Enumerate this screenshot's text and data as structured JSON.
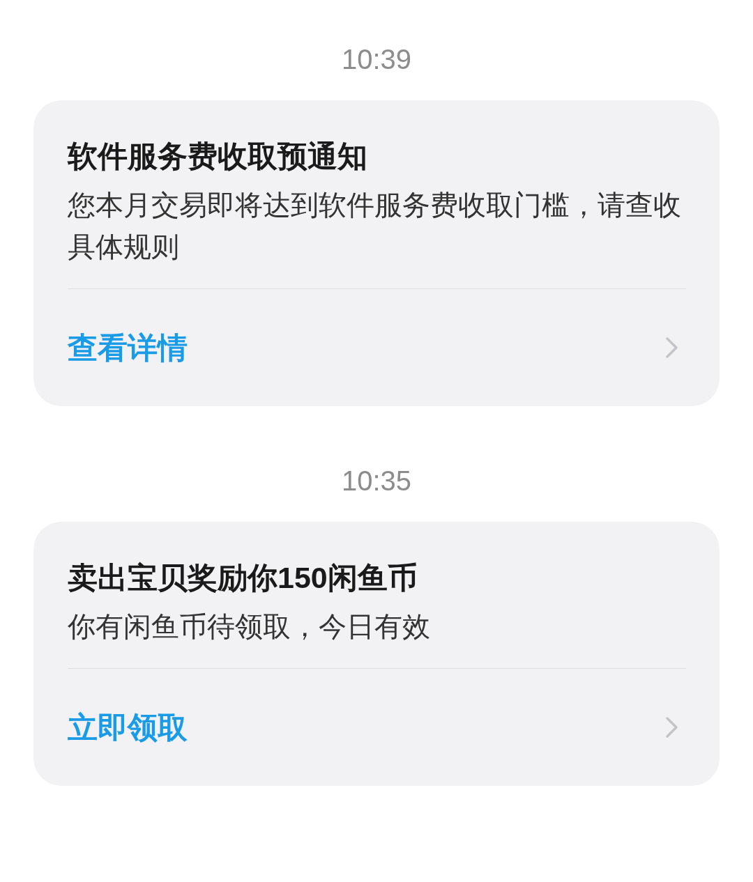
{
  "messages": [
    {
      "time": "10:39",
      "title": "软件服务费收取预通知",
      "body": "您本月交易即将达到软件服务费收取门槛，请查收具体规则",
      "action": "查看详情"
    },
    {
      "time": "10:35",
      "title": "卖出宝贝奖励你150闲鱼币",
      "body": "你有闲鱼币待领取，今日有效",
      "action": "立即领取"
    }
  ]
}
